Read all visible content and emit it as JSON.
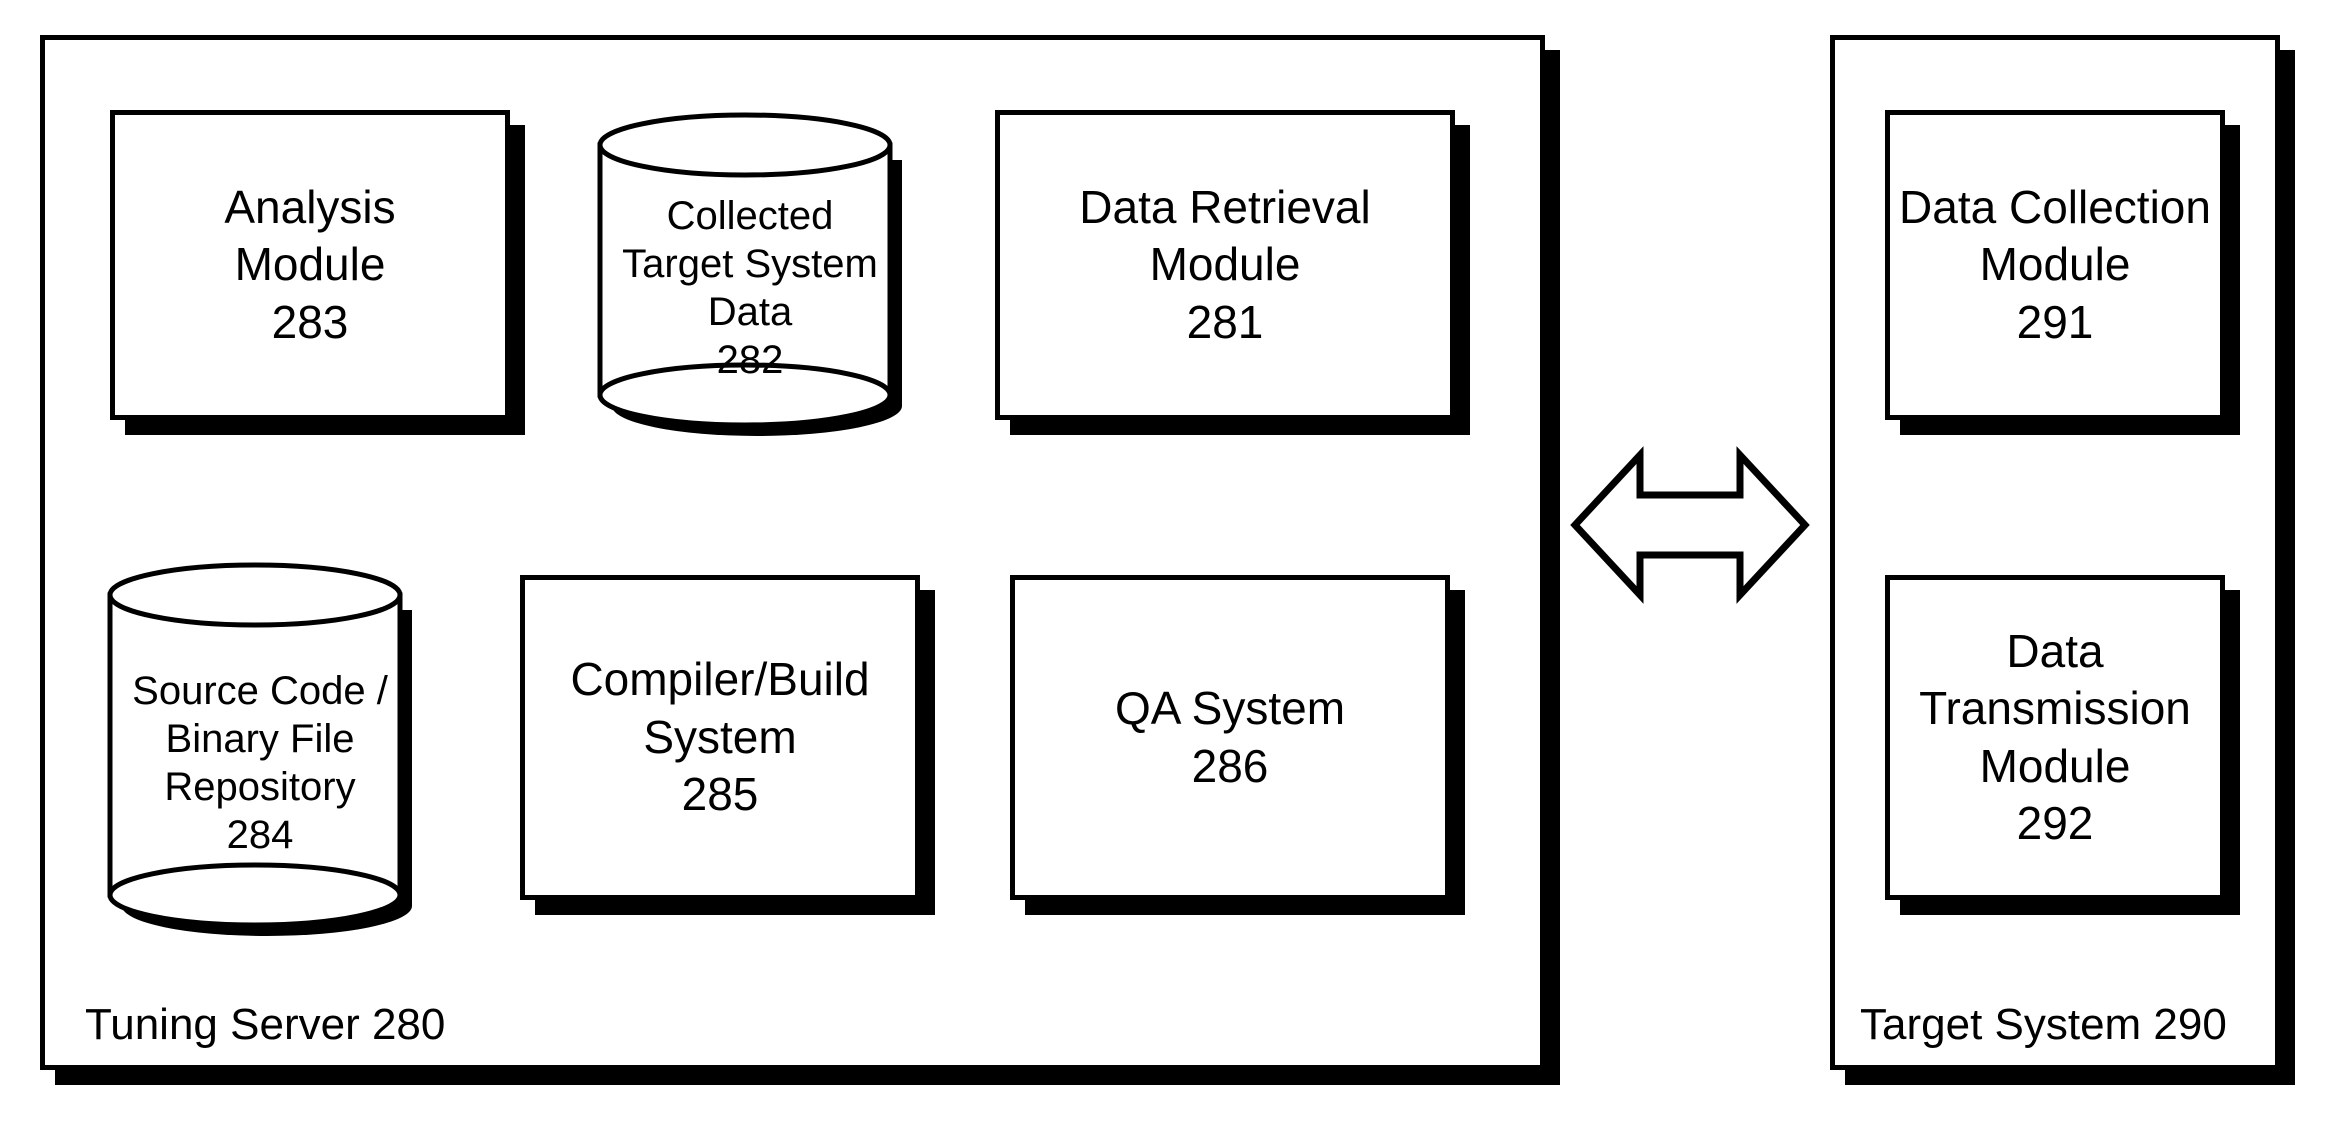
{
  "tuningServer": {
    "label": "Tuning Server 280",
    "analysisModule": {
      "line1": "Analysis",
      "line2": "Module",
      "num": "283"
    },
    "collectedData": {
      "line1": "Collected",
      "line2": "Target System",
      "line3": "Data",
      "num": "282"
    },
    "dataRetrieval": {
      "line1": "Data Retrieval",
      "line2": "Module",
      "num": "281"
    },
    "sourceRepo": {
      "line1": "Source Code /",
      "line2": "Binary File",
      "line3": "Repository",
      "num": "284"
    },
    "compiler": {
      "line1": "Compiler/Build",
      "line2": "System",
      "num": "285"
    },
    "qa": {
      "line1": "QA System",
      "num": "286"
    }
  },
  "targetSystem": {
    "label": "Target System 290",
    "dataCollection": {
      "line1": "Data Collection",
      "line2": "Module",
      "num": "291"
    },
    "dataTransmission": {
      "line1": "Data",
      "line2": "Transmission",
      "line3": "Module",
      "num": "292"
    }
  }
}
